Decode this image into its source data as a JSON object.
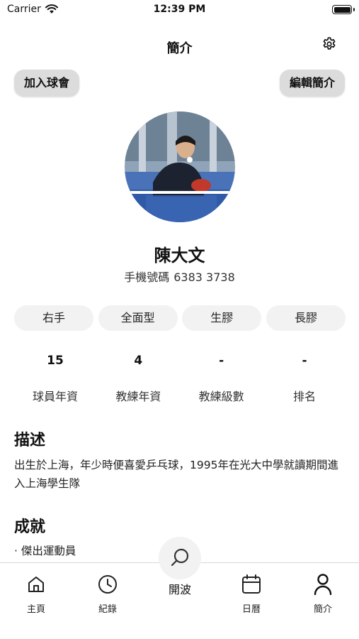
{
  "status_bar": {
    "carrier": "Carrier",
    "time": "12:39 PM"
  },
  "header": {
    "title": "簡介"
  },
  "actions": {
    "join_club": "加入球會",
    "edit_profile": "編輯簡介"
  },
  "profile": {
    "name": "陳大文",
    "phone_label": "手機號碼",
    "phone_number": "6383 3738"
  },
  "tags": [
    "右手",
    "全面型",
    "生膠",
    "長膠"
  ],
  "stats": [
    {
      "value": "15",
      "label": "球員年資"
    },
    {
      "value": "4",
      "label": "教練年資"
    },
    {
      "value": "-",
      "label": "教練級數"
    },
    {
      "value": "-",
      "label": "排名"
    }
  ],
  "description": {
    "title": "描述",
    "text": "出生於上海，年少時便喜愛乒乓球，1995年在光大中學就讀期間進入上海學生隊"
  },
  "achievements": {
    "title": "成就",
    "items": [
      "· 傑出運動員"
    ]
  },
  "tab_bar": {
    "home": "主頁",
    "records": "紀錄",
    "center": "開波",
    "calendar": "日曆",
    "profile": "簡介"
  },
  "icons": {
    "wifi": "wifi-icon",
    "battery": "battery-icon",
    "settings": "gear-icon",
    "home": "home-icon",
    "records": "clock-icon",
    "center": "paddle-search-icon",
    "calendar": "calendar-icon",
    "profile": "person-icon"
  }
}
